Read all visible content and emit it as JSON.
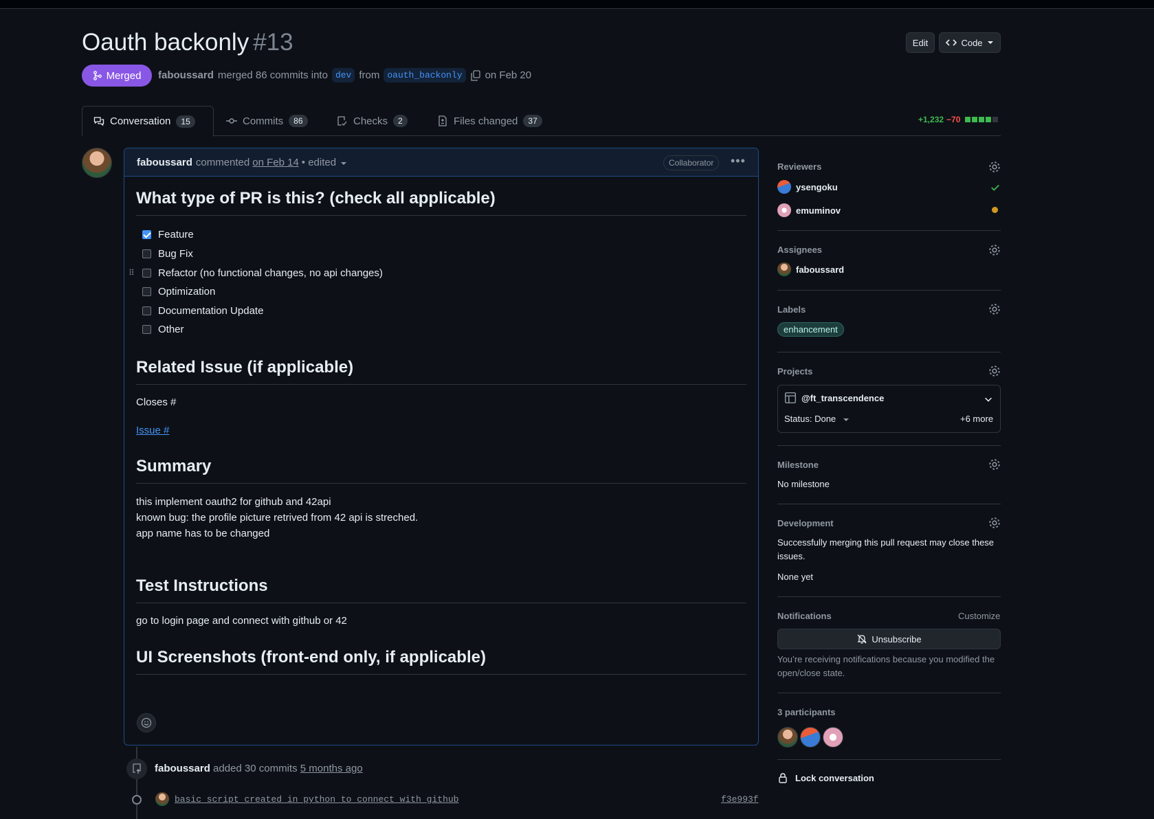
{
  "pr": {
    "title": "Oauth backonly",
    "number": "#13",
    "edit_label": "Edit",
    "code_label": "Code",
    "status": "Merged",
    "author": "faboussard",
    "merge_text": "merged 86 commits into",
    "base_branch": "dev",
    "from_text": "from",
    "head_branch": "oauth_backonly",
    "date_text": "on Feb 20"
  },
  "tabs": [
    {
      "label": "Conversation",
      "count": "15"
    },
    {
      "label": "Commits",
      "count": "86"
    },
    {
      "label": "Checks",
      "count": "2"
    },
    {
      "label": "Files changed",
      "count": "37"
    }
  ],
  "diffstat": {
    "additions": "+1,232",
    "deletions": "−70"
  },
  "comment": {
    "author": "faboussard",
    "action": "commented",
    "date": "on Feb 14",
    "edited": "• edited",
    "role": "Collaborator",
    "h_pr_type": "What type of PR is this? (check all applicable)",
    "tasks": [
      {
        "label": "Feature",
        "checked": true
      },
      {
        "label": "Bug Fix",
        "checked": false
      },
      {
        "label": "Refactor (no functional changes, no api changes)",
        "checked": false
      },
      {
        "label": "Optimization",
        "checked": false
      },
      {
        "label": "Documentation Update",
        "checked": false
      },
      {
        "label": "Other",
        "checked": false
      }
    ],
    "h_related": "Related Issue (if applicable)",
    "closes": "Closes #",
    "issue_link": "Issue #",
    "h_summary": "Summary",
    "summary_lines": [
      "this implement oauth2 for github and 42api",
      "known bug: the profile picture retrived from 42 api is streched.",
      "app name has to be changed"
    ],
    "h_test": "Test Instructions",
    "test_text": "go to login page and connect with github or 42",
    "h_screens": "UI Screenshots (front-end only, if applicable)"
  },
  "timeline": {
    "author": "faboussard",
    "action": "added 30 commits",
    "time": "5 months ago",
    "commit_message": "basic script created in python to connect with github",
    "commit_sha": "f3e993f"
  },
  "sidebar": {
    "reviewers_title": "Reviewers",
    "reviewers": [
      {
        "name": "ysengoku",
        "status": "approved"
      },
      {
        "name": "emuminov",
        "status": "pending"
      }
    ],
    "assignees_title": "Assignees",
    "assignee": "faboussard",
    "labels_title": "Labels",
    "label": "enhancement",
    "projects_title": "Projects",
    "project_name": "@ft_transcendence",
    "project_status": "Status: Done",
    "project_more": "+6 more",
    "milestone_title": "Milestone",
    "milestone_value": "No milestone",
    "development_title": "Development",
    "development_text": "Successfully merging this pull request may close these issues.",
    "development_value": "None yet",
    "notifications_title": "Notifications",
    "customize": "Customize",
    "unsubscribe": "Unsubscribe",
    "notif_reason": "You’re receiving notifications because you modified the open/close state.",
    "participants": "3 participants",
    "lock": "Lock conversation"
  },
  "colors": {
    "merged": "#8957e5",
    "link": "#4493f8",
    "added": "#3fb950",
    "deleted": "#f85149",
    "pending": "#d29922"
  }
}
